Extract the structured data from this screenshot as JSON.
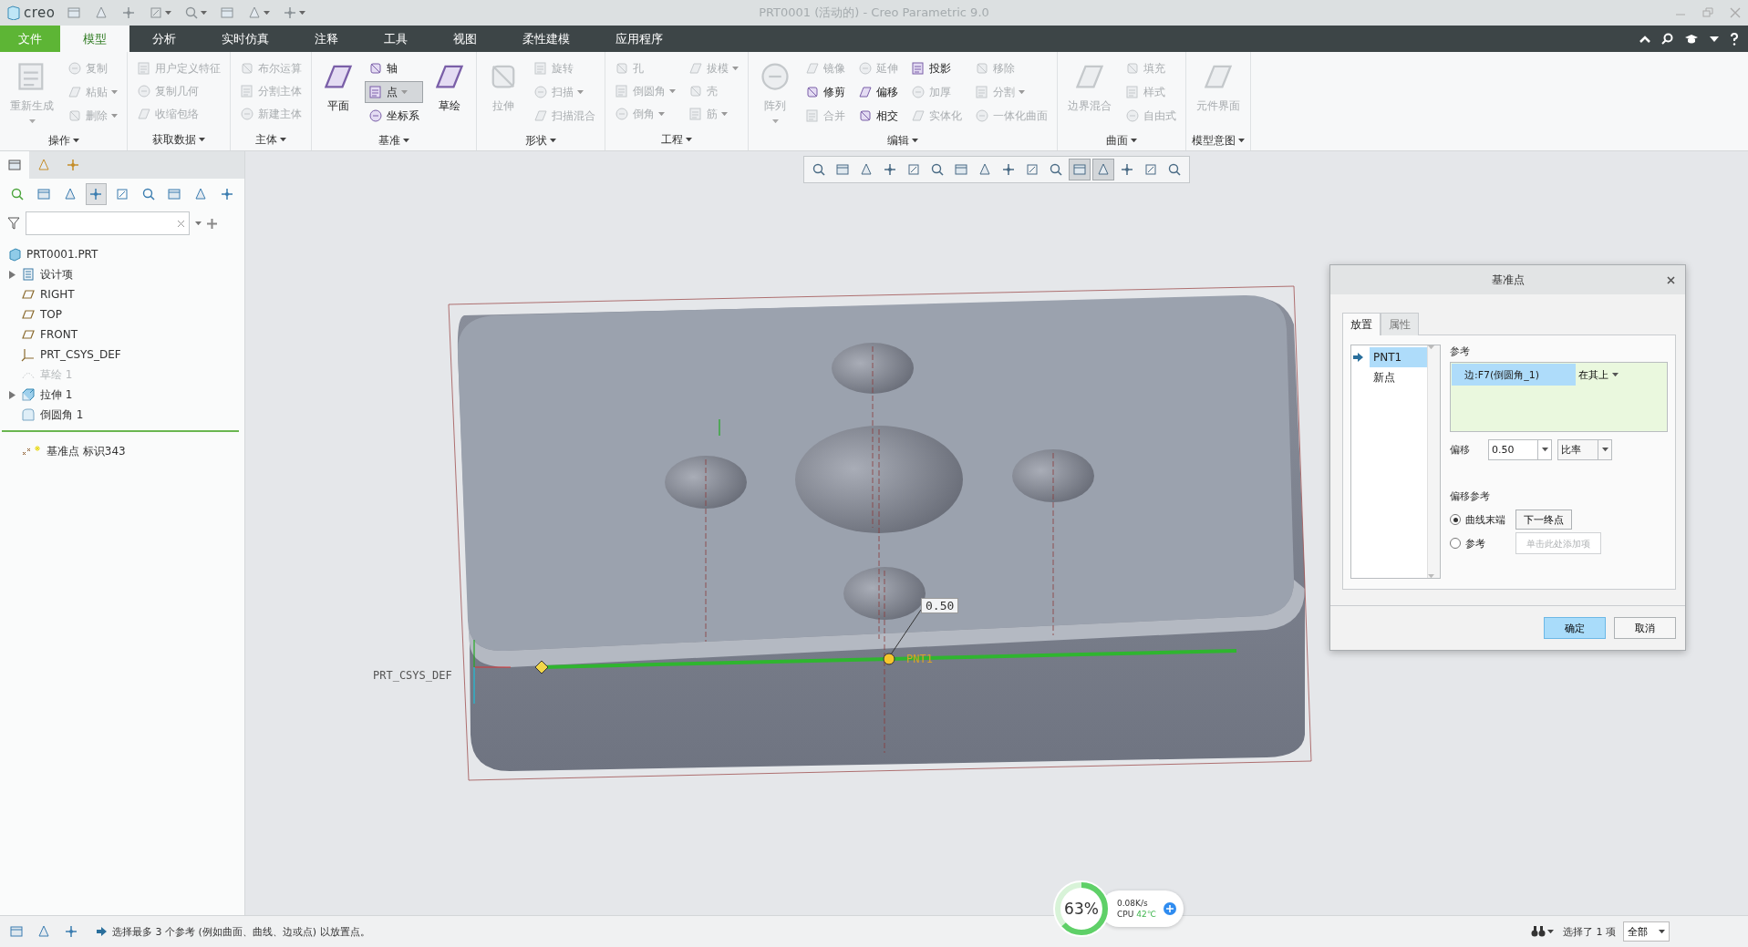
{
  "window": {
    "logo": "creo",
    "title": "PRT0001 (活动的) - Creo Parametric 9.0"
  },
  "menu_tabs": [
    {
      "label": "文件",
      "kind": "file",
      "selected": false
    },
    {
      "label": "模型",
      "kind": "tab",
      "selected": true
    },
    {
      "label": "分析",
      "kind": "tab",
      "selected": false
    },
    {
      "label": "实时仿真",
      "kind": "tab",
      "selected": false
    },
    {
      "label": "注释",
      "kind": "tab",
      "selected": false
    },
    {
      "label": "工具",
      "kind": "tab",
      "selected": false
    },
    {
      "label": "视图",
      "kind": "tab",
      "selected": false
    },
    {
      "label": "柔性建模",
      "kind": "tab",
      "selected": false
    },
    {
      "label": "应用程序",
      "kind": "tab",
      "selected": false
    }
  ],
  "ribbon": {
    "groups": [
      {
        "label": "操作",
        "columns": [
          [
            {
              "label": "重新生成",
              "kind": "large",
              "disabled": true,
              "dropdown": true,
              "selected": false
            }
          ],
          [
            {
              "label": "复制",
              "kind": "small",
              "disabled": true,
              "dropdown": false,
              "selected": false
            },
            {
              "label": "粘贴",
              "kind": "small",
              "disabled": true,
              "dropdown": true,
              "selected": false
            },
            {
              "label": "删除",
              "kind": "small",
              "disabled": true,
              "dropdown": true,
              "selected": false
            }
          ]
        ]
      },
      {
        "label": "获取数据",
        "columns": [
          [
            {
              "label": "用户定义特征",
              "kind": "small",
              "disabled": true,
              "dropdown": false,
              "selected": false
            },
            {
              "label": "复制几何",
              "kind": "small",
              "disabled": true,
              "dropdown": false,
              "selected": false
            },
            {
              "label": "收缩包络",
              "kind": "small",
              "disabled": true,
              "dropdown": false,
              "selected": false
            }
          ]
        ]
      },
      {
        "label": "主体",
        "columns": [
          [
            {
              "label": "布尔运算",
              "kind": "small",
              "disabled": true,
              "dropdown": false,
              "selected": false
            },
            {
              "label": "分割主体",
              "kind": "small",
              "disabled": true,
              "dropdown": false,
              "selected": false
            },
            {
              "label": "新建主体",
              "kind": "small",
              "disabled": true,
              "dropdown": false,
              "selected": false
            }
          ]
        ]
      },
      {
        "label": "基准",
        "columns": [
          [
            {
              "label": "平面",
              "kind": "large",
              "disabled": false,
              "dropdown": false,
              "selected": false
            }
          ],
          [
            {
              "label": "轴",
              "kind": "small",
              "disabled": false,
              "dropdown": false,
              "selected": false
            },
            {
              "label": "点",
              "kind": "small",
              "disabled": false,
              "dropdown": true,
              "selected": true
            },
            {
              "label": "坐标系",
              "kind": "small",
              "disabled": false,
              "dropdown": false,
              "selected": false
            }
          ],
          [
            {
              "label": "草绘",
              "kind": "large",
              "disabled": false,
              "dropdown": false,
              "selected": false
            }
          ]
        ]
      },
      {
        "label": "形状",
        "columns": [
          [
            {
              "label": "拉伸",
              "kind": "large",
              "disabled": true,
              "dropdown": false,
              "selected": false
            }
          ],
          [
            {
              "label": "旋转",
              "kind": "small",
              "disabled": true,
              "dropdown": false,
              "selected": false
            },
            {
              "label": "扫描",
              "kind": "small",
              "disabled": true,
              "dropdown": true,
              "selected": false
            },
            {
              "label": "扫描混合",
              "kind": "small",
              "disabled": true,
              "dropdown": false,
              "selected": false
            }
          ]
        ]
      },
      {
        "label": "工程",
        "columns": [
          [
            {
              "label": "孔",
              "kind": "small",
              "disabled": true,
              "dropdown": false,
              "selected": false
            },
            {
              "label": "倒圆角",
              "kind": "small",
              "disabled": true,
              "dropdown": true,
              "selected": false
            },
            {
              "label": "倒角",
              "kind": "small",
              "disabled": true,
              "dropdown": true,
              "selected": false
            }
          ],
          [
            {
              "label": "拔模",
              "kind": "small",
              "disabled": true,
              "dropdown": true,
              "selected": false
            },
            {
              "label": "壳",
              "kind": "small",
              "disabled": true,
              "dropdown": false,
              "selected": false
            },
            {
              "label": "筋",
              "kind": "small",
              "disabled": true,
              "dropdown": true,
              "selected": false
            }
          ]
        ]
      },
      {
        "label": "编辑",
        "columns": [
          [
            {
              "label": "阵列",
              "kind": "large",
              "disabled": true,
              "dropdown": true,
              "selected": false
            }
          ],
          [
            {
              "label": "镜像",
              "kind": "small",
              "disabled": true,
              "dropdown": false,
              "selected": false
            },
            {
              "label": "修剪",
              "kind": "small",
              "disabled": false,
              "dropdown": false,
              "selected": false
            },
            {
              "label": "合并",
              "kind": "small",
              "disabled": true,
              "dropdown": false,
              "selected": false
            }
          ],
          [
            {
              "label": "延伸",
              "kind": "small",
              "disabled": true,
              "dropdown": false,
              "selected": false
            },
            {
              "label": "偏移",
              "kind": "small",
              "disabled": false,
              "dropdown": false,
              "selected": false
            },
            {
              "label": "相交",
              "kind": "small",
              "disabled": false,
              "dropdown": false,
              "selected": false
            }
          ],
          [
            {
              "label": "投影",
              "kind": "small",
              "disabled": false,
              "dropdown": false,
              "selected": false
            },
            {
              "label": "加厚",
              "kind": "small",
              "disabled": true,
              "dropdown": false,
              "selected": false
            },
            {
              "label": "实体化",
              "kind": "small",
              "disabled": true,
              "dropdown": false,
              "selected": false
            }
          ],
          [
            {
              "label": "移除",
              "kind": "small",
              "disabled": true,
              "dropdown": false,
              "selected": false
            },
            {
              "label": "分割",
              "kind": "small",
              "disabled": true,
              "dropdown": true,
              "selected": false
            },
            {
              "label": "一体化曲面",
              "kind": "small",
              "disabled": true,
              "dropdown": false,
              "selected": false
            }
          ]
        ]
      },
      {
        "label": "曲面",
        "columns": [
          [
            {
              "label": "边界混合",
              "kind": "large",
              "disabled": true,
              "dropdown": false,
              "selected": false
            }
          ],
          [
            {
              "label": "填充",
              "kind": "small",
              "disabled": true,
              "dropdown": false,
              "selected": false
            },
            {
              "label": "样式",
              "kind": "small",
              "disabled": true,
              "dropdown": false,
              "selected": false
            },
            {
              "label": "自由式",
              "kind": "small",
              "disabled": true,
              "dropdown": false,
              "selected": false
            }
          ]
        ]
      },
      {
        "label": "模型意图",
        "columns": [
          [
            {
              "label": "元件界面",
              "kind": "large",
              "disabled": true,
              "dropdown": false,
              "selected": false
            }
          ]
        ]
      }
    ]
  },
  "left_panel": {
    "tabs": [
      {
        "selected": true
      },
      {
        "selected": false
      },
      {
        "selected": false
      }
    ],
    "tree": [
      {
        "label": "PRT0001.PRT",
        "kind": "part",
        "disabled": false
      },
      {
        "label": "设计项",
        "kind": "folder",
        "disabled": false,
        "expanded": false
      },
      {
        "label": "RIGHT",
        "kind": "plane",
        "disabled": false
      },
      {
        "label": "TOP",
        "kind": "plane",
        "disabled": false
      },
      {
        "label": "FRONT",
        "kind": "plane",
        "disabled": false
      },
      {
        "label": "PRT_CSYS_DEF",
        "kind": "csys",
        "disabled": false
      },
      {
        "label": "草绘 1",
        "kind": "sketch",
        "disabled": true
      },
      {
        "label": "拉伸 1",
        "kind": "extrude",
        "disabled": false,
        "expanded": false
      },
      {
        "label": "倒圆角 1",
        "kind": "round",
        "disabled": false
      }
    ],
    "new_feature": {
      "label": "基准点 标识343"
    }
  },
  "view_toolbar": [
    {
      "selected": false
    },
    {
      "selected": false
    },
    {
      "selected": false
    },
    {
      "selected": false
    },
    {
      "selected": false
    },
    {
      "selected": false
    },
    {
      "selected": false
    },
    {
      "selected": false
    },
    {
      "selected": false
    },
    {
      "selected": false
    },
    {
      "selected": false
    },
    {
      "selected": true
    },
    {
      "selected": true
    },
    {
      "selected": false
    },
    {
      "selected": false
    },
    {
      "selected": false
    }
  ],
  "viewport": {
    "csys_label": "PRT_CSYS_DEF",
    "dimension": "0.50",
    "point_label": "PNT1"
  },
  "dialog": {
    "title": "基准点",
    "tabs": [
      {
        "label": "放置",
        "selected": true
      },
      {
        "label": "属性",
        "selected": false
      }
    ],
    "points": [
      {
        "label": "PNT1",
        "selected": true
      },
      {
        "label": "新点",
        "selected": false
      }
    ],
    "references_label": "参考",
    "reference": {
      "label": "边:F7(倒圆角_1)",
      "constraint": "在其上"
    },
    "offset_label": "偏移",
    "offset_value": "0.50",
    "offset_type": "比率",
    "offset_ref_label": "偏移参考",
    "offset_refs": [
      {
        "label": "曲线末端",
        "selected": true,
        "kind": "button",
        "action": "下一终点"
      },
      {
        "label": "参考",
        "selected": false,
        "kind": "field",
        "placeholder": "单击此处添加项"
      }
    ],
    "buttons": [
      {
        "label": "确定",
        "kind": "primary"
      },
      {
        "label": "取消",
        "kind": "normal"
      }
    ]
  },
  "status_bar": {
    "message": "选择最多 3 个参考 (例如曲面、曲线、边或点) 以放置点。",
    "selection": "选择了 1 项",
    "filter": "全部"
  },
  "cpu_widget": {
    "percent": "63%",
    "net_speed": "0.08K/s",
    "cpu_label": "CPU",
    "temperature": "42℃"
  }
}
